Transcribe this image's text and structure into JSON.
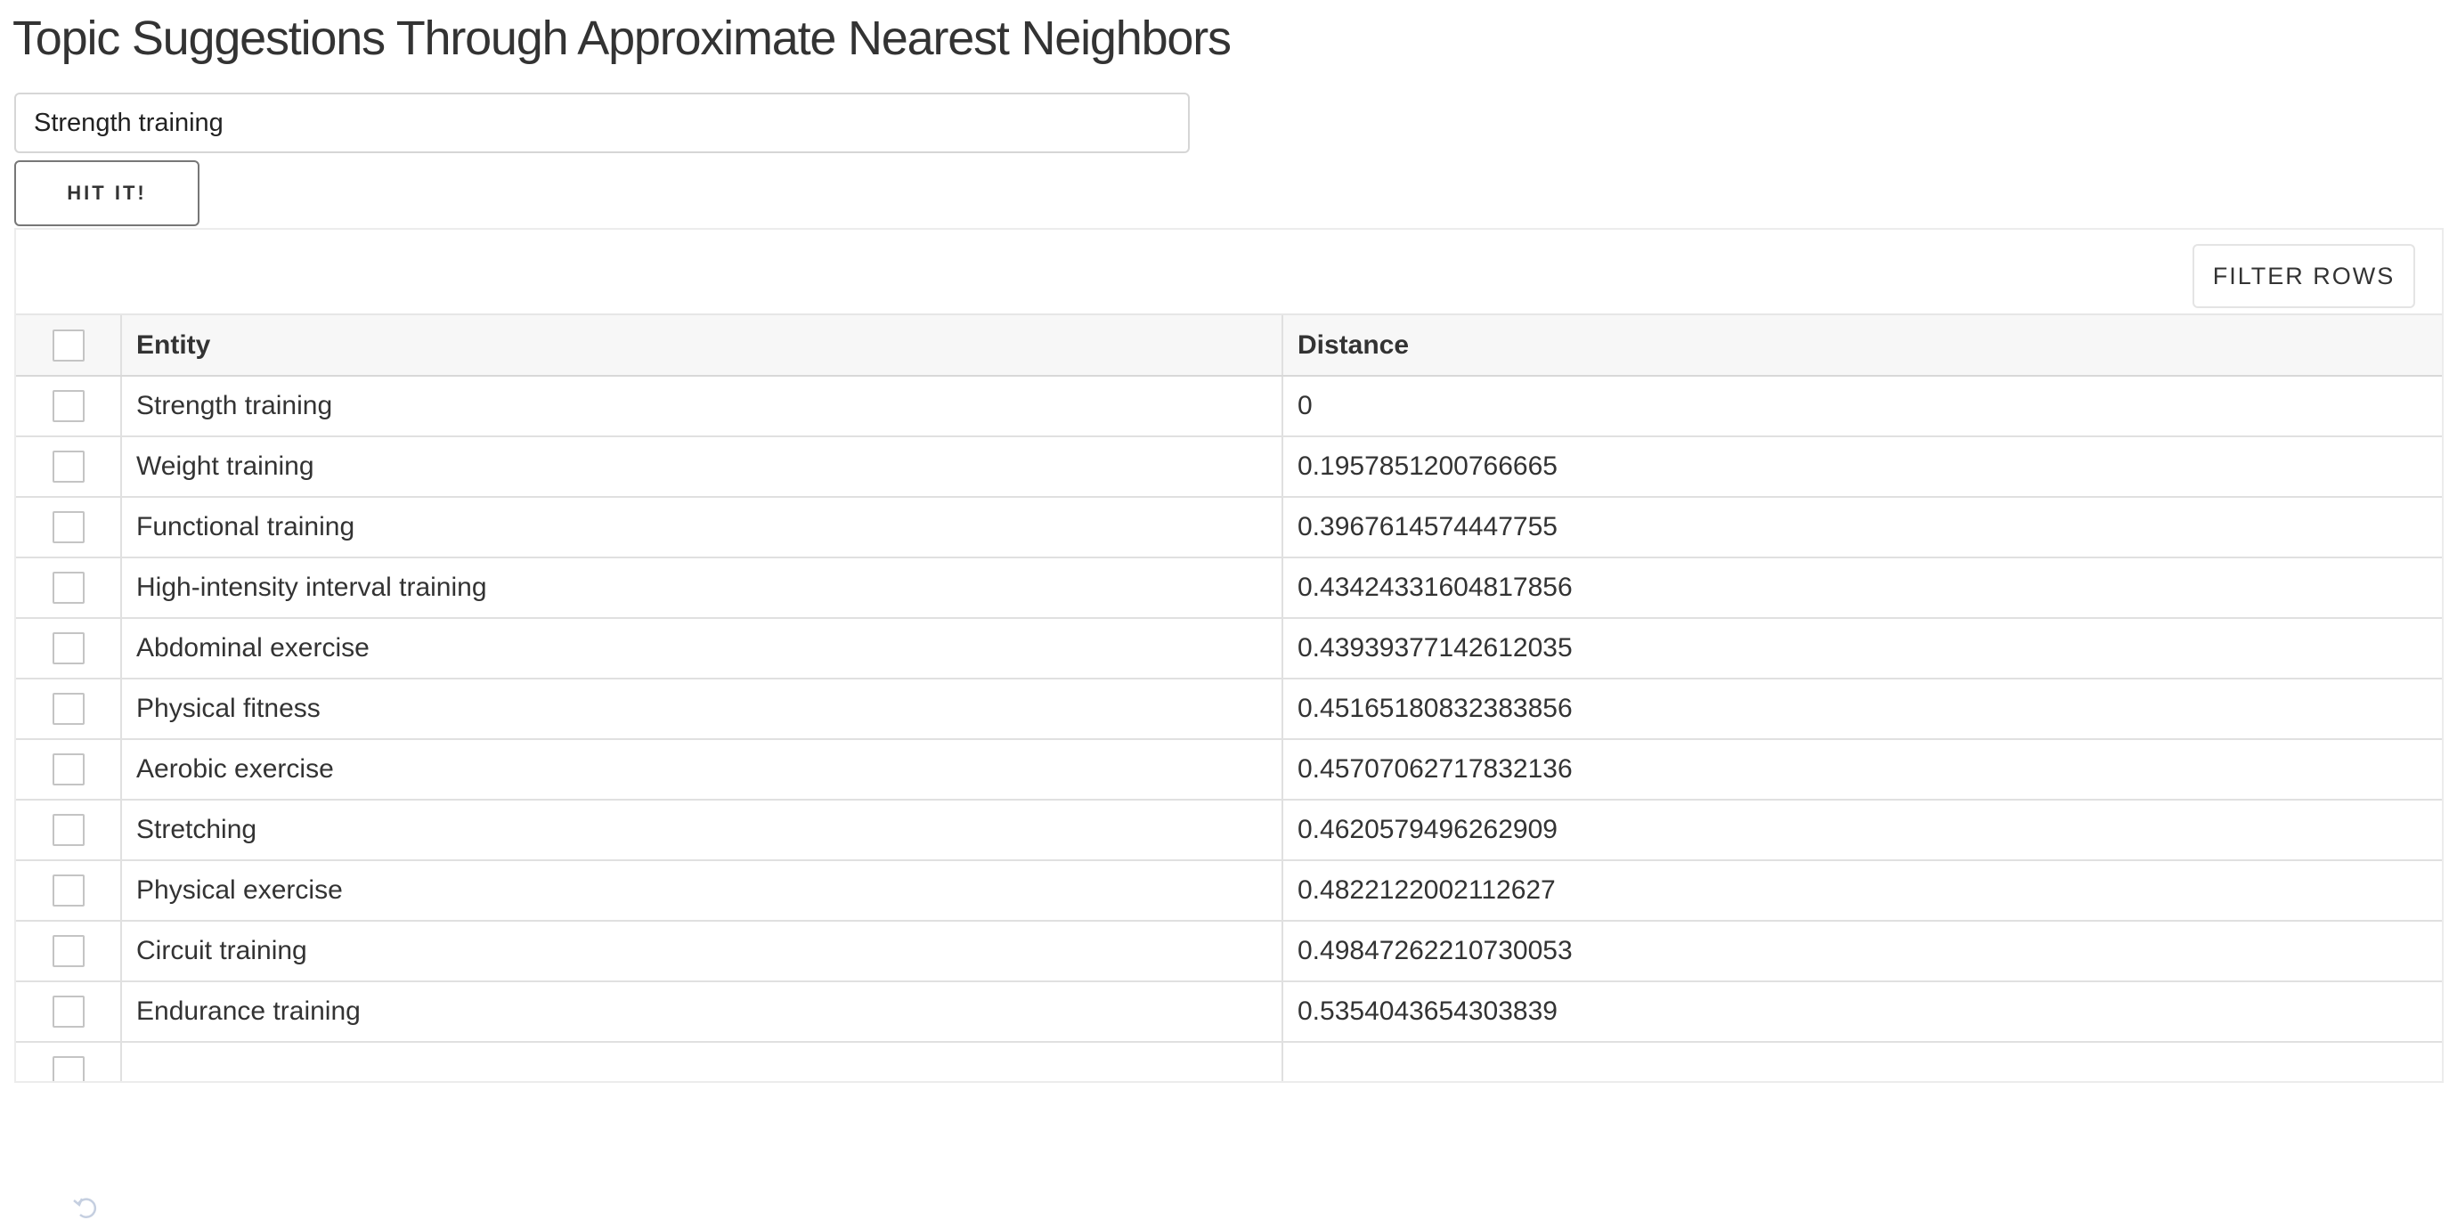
{
  "page": {
    "title": "Topic Suggestions Through Approximate Nearest Neighbors"
  },
  "search": {
    "value": "Strength training"
  },
  "submit_button": {
    "label": "HIT IT!"
  },
  "grid": {
    "filter_label": "FILTER ROWS",
    "columns": [
      "Entity",
      "Distance"
    ],
    "rows": [
      {
        "entity": "Strength training",
        "distance": "0"
      },
      {
        "entity": "Weight training",
        "distance": "0.1957851200766665"
      },
      {
        "entity": "Functional training",
        "distance": "0.3967614574447755"
      },
      {
        "entity": "High-intensity interval training",
        "distance": "0.43424331604817856"
      },
      {
        "entity": "Abdominal exercise",
        "distance": "0.43939377142612035"
      },
      {
        "entity": "Physical fitness",
        "distance": "0.45165180832383856"
      },
      {
        "entity": "Aerobic exercise",
        "distance": "0.45707062717832136"
      },
      {
        "entity": "Stretching",
        "distance": "0.4620579496262909"
      },
      {
        "entity": "Physical exercise",
        "distance": "0.4822122002112627"
      },
      {
        "entity": "Circuit training",
        "distance": "0.49847262210730053"
      },
      {
        "entity": "Endurance training",
        "distance": "0.5354043654303839"
      }
    ]
  },
  "icons": {
    "checkbox": "checkbox-icon",
    "undo": "undo-icon"
  },
  "colors": {
    "text": "#333333",
    "border": "#e0e0e0",
    "header_bg": "#f7f7f7"
  }
}
